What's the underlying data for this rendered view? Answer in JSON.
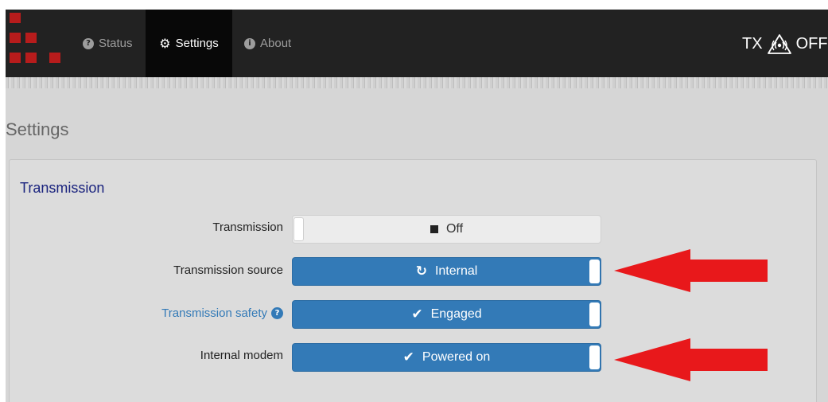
{
  "nav": {
    "items": [
      {
        "label": "Status",
        "icon": "question-circle-icon"
      },
      {
        "label": "Settings",
        "icon": "gear-icon",
        "active": true
      },
      {
        "label": "About",
        "icon": "info-circle-icon"
      }
    ],
    "tx_label": "TX",
    "tx_state": "OFF",
    "tx_icon": "radio-tower-icon"
  },
  "page": {
    "title": "Settings"
  },
  "section": {
    "heading": "Transmission"
  },
  "rows": [
    {
      "label": "Transmission",
      "value": "Off",
      "state": "off",
      "icon": "stop-icon"
    },
    {
      "label": "Transmission source",
      "value": "Internal",
      "state": "on",
      "icon": "refresh-icon"
    },
    {
      "label": "Transmission safety",
      "value": "Engaged",
      "state": "on",
      "icon": "check-icon",
      "help_icon": "question-circle-icon"
    },
    {
      "label": "Internal modem",
      "value": "Powered on",
      "state": "on",
      "icon": "check-icon"
    }
  ],
  "colors": {
    "navbar": "#222222",
    "logo": "#b71c1c",
    "toggle_on": "#337ab7",
    "toggle_off": "#ececec",
    "heading": "#1a237e",
    "annotation_arrow": "#e8181b"
  }
}
